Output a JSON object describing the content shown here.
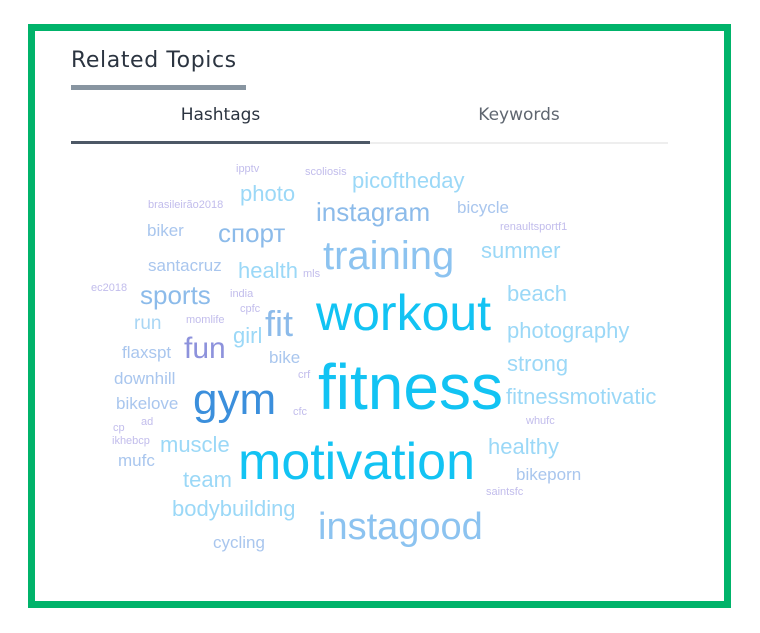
{
  "header": {
    "title": "Related Topics"
  },
  "tabs": [
    {
      "label": "Hashtags",
      "active": true
    },
    {
      "label": "Keywords",
      "active": false
    }
  ],
  "colors": {
    "frame_border": "#00b36a",
    "title_text": "#2b3440",
    "title_underline": "#8895a1",
    "tab_active_line": "#4d5866",
    "tab_inactive_line": "#eeeeee"
  },
  "word_cloud": {
    "words": [
      {
        "text": "fitness",
        "color": "#12c3f3"
      },
      {
        "text": "workout",
        "color": "#12c3f3"
      },
      {
        "text": "motivation",
        "color": "#12c3f3"
      },
      {
        "text": "gym",
        "color": "#3b8fdc"
      },
      {
        "text": "instagood",
        "color": "#8cc3f0"
      },
      {
        "text": "training",
        "color": "#8cc3f0"
      },
      {
        "text": "fit",
        "color": "#8cbbea"
      },
      {
        "text": "fun",
        "color": "#8d92dc"
      },
      {
        "text": "instagram",
        "color": "#8cbbea"
      },
      {
        "text": "спорт",
        "color": "#8cbbea"
      },
      {
        "text": "sports",
        "color": "#8cbbea"
      },
      {
        "text": "picoftheday",
        "color": "#9bd8f7"
      },
      {
        "text": "photo",
        "color": "#9bd8f7"
      },
      {
        "text": "health",
        "color": "#9bd8f7"
      },
      {
        "text": "summer",
        "color": "#9bd8f7"
      },
      {
        "text": "beach",
        "color": "#9bd8f7"
      },
      {
        "text": "photography",
        "color": "#9bd8f7"
      },
      {
        "text": "strong",
        "color": "#9bd8f7"
      },
      {
        "text": "fitnessmotivatic",
        "color": "#9bd8f7"
      },
      {
        "text": "healthy",
        "color": "#9bd8f7"
      },
      {
        "text": "muscle",
        "color": "#9bd8f7"
      },
      {
        "text": "team",
        "color": "#9bd8f7"
      },
      {
        "text": "bodybuilding",
        "color": "#9bd8f7"
      },
      {
        "text": "girl",
        "color": "#9bd8f7"
      },
      {
        "text": "bicycle",
        "color": "#a9c6ee"
      },
      {
        "text": "bikeporn",
        "color": "#a9c6ee"
      },
      {
        "text": "cycling",
        "color": "#a9c6ee"
      },
      {
        "text": "run",
        "color": "#a9d6f4"
      },
      {
        "text": "biker",
        "color": "#a9c6ee"
      },
      {
        "text": "santacruz",
        "color": "#a9c6ee"
      },
      {
        "text": "flaxspt",
        "color": "#a9c6ee"
      },
      {
        "text": "downhill",
        "color": "#a9c6ee"
      },
      {
        "text": "bikelove",
        "color": "#a9c6ee"
      },
      {
        "text": "mufc",
        "color": "#a9c6ee"
      },
      {
        "text": "bike",
        "color": "#a9c6ee"
      },
      {
        "text": "ipptv",
        "color": "#c2bdec"
      },
      {
        "text": "scoliosis",
        "color": "#c2bdec"
      },
      {
        "text": "brasileirão2018",
        "color": "#c2bdec"
      },
      {
        "text": "renaultsportf1",
        "color": "#c2bdec"
      },
      {
        "text": "mls",
        "color": "#c2bdec"
      },
      {
        "text": "ec2018",
        "color": "#c2bdec"
      },
      {
        "text": "india",
        "color": "#c2bdec"
      },
      {
        "text": "cpfc",
        "color": "#c2bdec"
      },
      {
        "text": "momlife",
        "color": "#c2bdec"
      },
      {
        "text": "crf",
        "color": "#c2bdec"
      },
      {
        "text": "cfc",
        "color": "#c2bdec"
      },
      {
        "text": "whufc",
        "color": "#c2bdec"
      },
      {
        "text": "cp",
        "color": "#c2bdec"
      },
      {
        "text": "ad",
        "color": "#c2bdec"
      },
      {
        "text": "ikhebcp",
        "color": "#c2bdec"
      },
      {
        "text": "saintsfc",
        "color": "#c2bdec"
      }
    ]
  }
}
